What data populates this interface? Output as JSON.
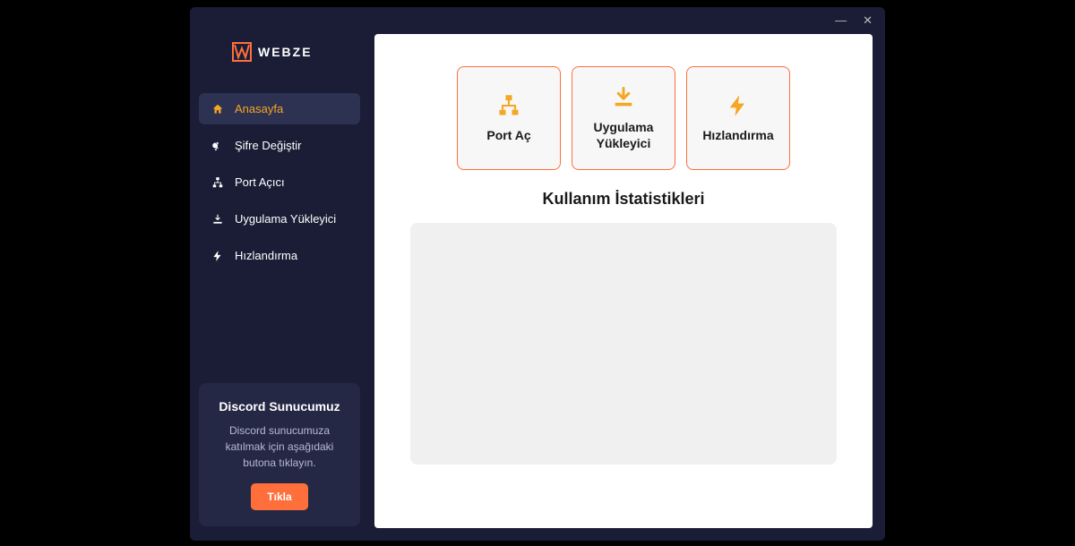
{
  "brand": {
    "name": "WEBZE"
  },
  "titlebar": {
    "minimize": "—",
    "close": "✕"
  },
  "sidebar": {
    "items": [
      {
        "icon": "home-icon",
        "label": "Anasayfa",
        "active": true
      },
      {
        "icon": "key-icon",
        "label": "Şifre Değiştir",
        "active": false
      },
      {
        "icon": "network-icon",
        "label": "Port Açıcı",
        "active": false
      },
      {
        "icon": "download-icon",
        "label": "Uygulama Yükleyici",
        "active": false
      },
      {
        "icon": "bolt-icon",
        "label": "Hızlandırma",
        "active": false
      }
    ]
  },
  "discord": {
    "title": "Discord Sunucumuz",
    "description": "Discord sunucumuza katılmak için aşağıdaki butona tıklayın.",
    "button": "Tıkla"
  },
  "main": {
    "cards": [
      {
        "icon": "network-icon",
        "label": "Port Aç"
      },
      {
        "icon": "download-icon",
        "label": "Uygulama Yükleyici"
      },
      {
        "icon": "bolt-icon",
        "label": "Hızlandırma"
      }
    ],
    "stats_title": "Kullanım İstatistikleri"
  },
  "colors": {
    "accent": "#ff6f3c",
    "highlight": "#f5a623",
    "sidebar_bg": "#1a1d35"
  }
}
